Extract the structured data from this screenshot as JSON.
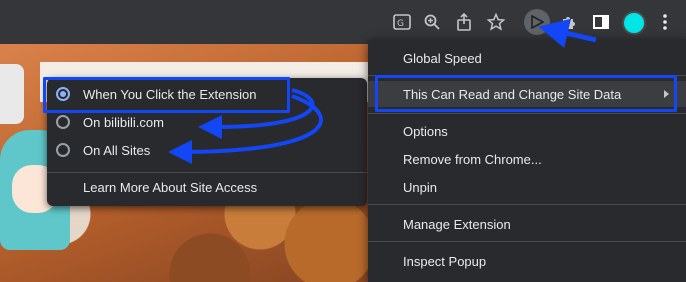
{
  "toolbar": {
    "icons": [
      "translate-icon",
      "zoom-icon",
      "share-icon",
      "bookmark-star-icon",
      "extension-play-icon",
      "puzzle-extensions-icon",
      "side-panel-icon",
      "profile-avatar",
      "more-vert-icon"
    ]
  },
  "context_menu": {
    "items": [
      {
        "label": "Global Speed"
      },
      {
        "label": "This Can Read and Change Site Data"
      },
      {
        "label": "Options"
      },
      {
        "label": "Remove from Chrome..."
      },
      {
        "label": "Unpin"
      },
      {
        "label": "Manage Extension"
      },
      {
        "label": "Inspect Popup"
      }
    ]
  },
  "site_access_menu": {
    "options": [
      {
        "label": "When You Click the Extension",
        "selected": true
      },
      {
        "label": "On bilibili.com",
        "selected": false
      },
      {
        "label": "On All Sites",
        "selected": false
      }
    ],
    "learn_more": "Learn More About Site Access"
  },
  "colors": {
    "annotation": "#1346f5",
    "menu_bg": "#292a2d",
    "toolbar_bg": "#35363a",
    "radio_selected": "#8ab4f8",
    "avatar": "#00e5e5"
  }
}
